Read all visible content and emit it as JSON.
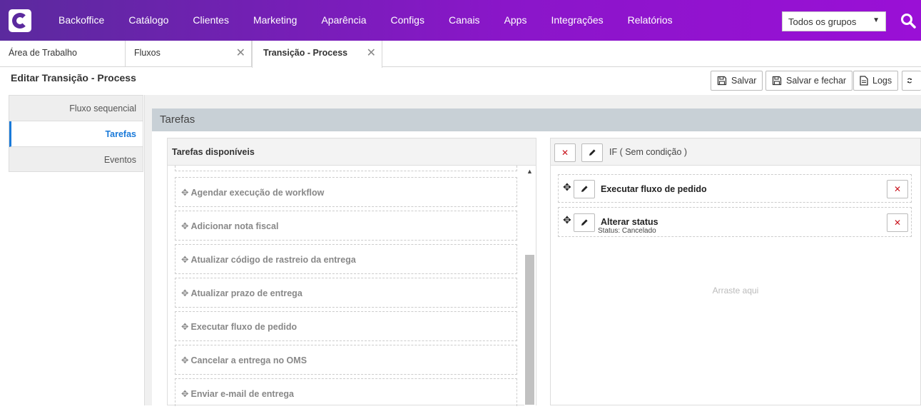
{
  "nav": {
    "items": [
      "Backoffice",
      "Catálogo",
      "Clientes",
      "Marketing",
      "Aparência",
      "Configs",
      "Canais",
      "Apps",
      "Integrações",
      "Relatórios"
    ],
    "group_select": "Todos os grupos"
  },
  "tabs": [
    {
      "label": "Área de Trabalho"
    },
    {
      "label": "Fluxos"
    },
    {
      "label": "Transição - Process"
    }
  ],
  "page": {
    "title": "Editar Transição - Process",
    "buttons": {
      "save": "Salvar",
      "save_close": "Salvar e fechar",
      "logs": "Logs"
    }
  },
  "sidemenu": [
    "Fluxo sequencial",
    "Tarefas",
    "Eventos"
  ],
  "section": {
    "title": "Tarefas"
  },
  "available": {
    "title": "Tarefas disponíveis",
    "items": [
      "Agendar execução de workflow",
      "Adicionar nota fiscal",
      "Atualizar código de rastreio da entrega",
      "Atualizar prazo de entrega",
      "Executar fluxo de pedido",
      "Cancelar a entrega no OMS",
      "Enviar e-mail de entrega"
    ]
  },
  "condition": {
    "label": "IF ( Sem condição )",
    "tasks": [
      {
        "title": "Executar fluxo de pedido",
        "sub": ""
      },
      {
        "title": "Alterar status",
        "sub": "Status: Cancelado"
      }
    ],
    "drop_hint": "Arraste aqui"
  },
  "colors": {
    "nav_start": "#5b2a9e",
    "nav_end": "#9a10d6",
    "accent": "#1a7ad9",
    "danger": "#c9151e"
  }
}
